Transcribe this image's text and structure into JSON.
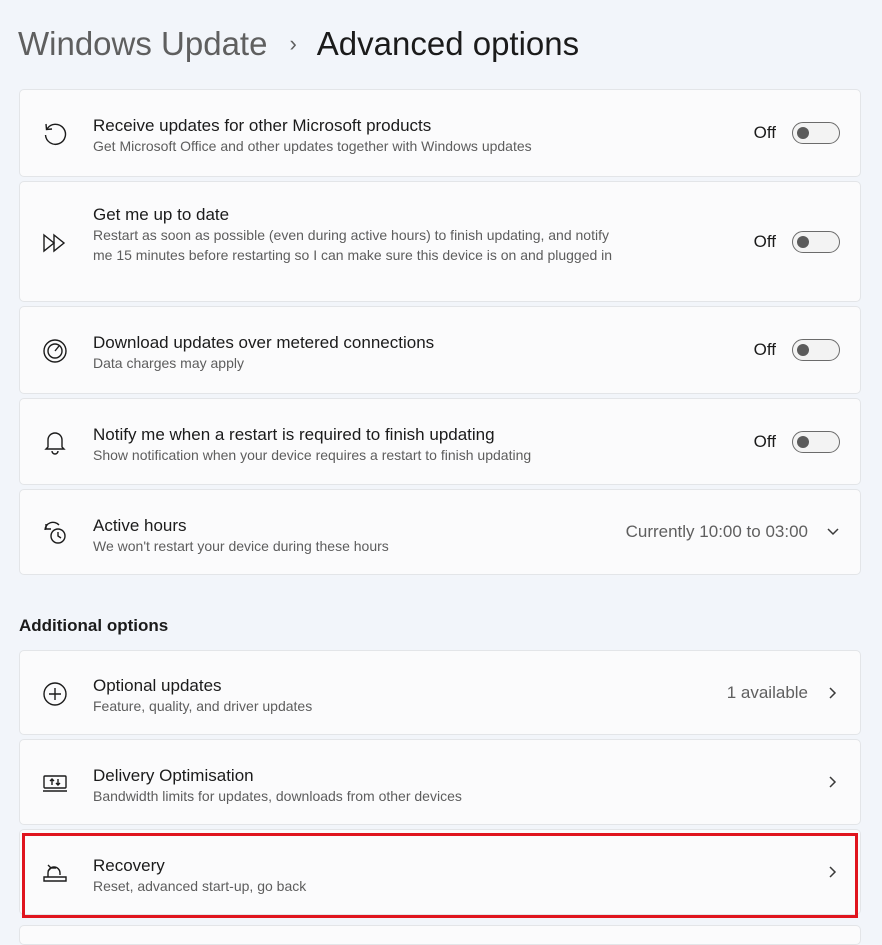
{
  "breadcrumb": {
    "parent": "Windows Update",
    "separator": "›",
    "current": "Advanced options"
  },
  "settings": [
    {
      "icon": "refresh-icon",
      "title": "Receive updates for other Microsoft products",
      "description": "Get Microsoft Office and other updates together with Windows updates",
      "state_label": "Off",
      "toggle_on": false
    },
    {
      "icon": "fast-forward-icon",
      "title": "Get me up to date",
      "description": "Restart as soon as possible (even during active hours) to finish updating, and notify me 15 minutes before restarting so I can make sure this device is on and plugged in",
      "state_label": "Off",
      "toggle_on": false
    },
    {
      "icon": "gauge-icon",
      "title": "Download updates over metered connections",
      "description": "Data charges may apply",
      "state_label": "Off",
      "toggle_on": false
    },
    {
      "icon": "bell-icon",
      "title": "Notify me when a restart is required to finish updating",
      "description": "Show notification when your device requires a restart to finish updating",
      "state_label": "Off",
      "toggle_on": false
    },
    {
      "icon": "clock-icon",
      "title": "Active hours",
      "description": "We won't restart your device during these hours",
      "value": "Currently 10:00 to 03:00",
      "chevron": "chevron-down-icon"
    }
  ],
  "additional": {
    "heading": "Additional options",
    "items": [
      {
        "icon": "plus-circle-icon",
        "title": "Optional updates",
        "description": "Feature, quality, and driver updates",
        "value": "1 available",
        "chevron": "chevron-right-icon"
      },
      {
        "icon": "delivery-optimisation-icon",
        "title": "Delivery Optimisation",
        "description": "Bandwidth limits for updates, downloads from other devices",
        "chevron": "chevron-right-icon"
      },
      {
        "icon": "recovery-icon",
        "title": "Recovery",
        "description": "Reset, advanced start-up, go back",
        "chevron": "chevron-right-icon",
        "highlighted": true
      }
    ]
  },
  "colors": {
    "background": "#f2f5fa",
    "card": "#fbfbfc",
    "highlight_border": "#e0141e"
  }
}
